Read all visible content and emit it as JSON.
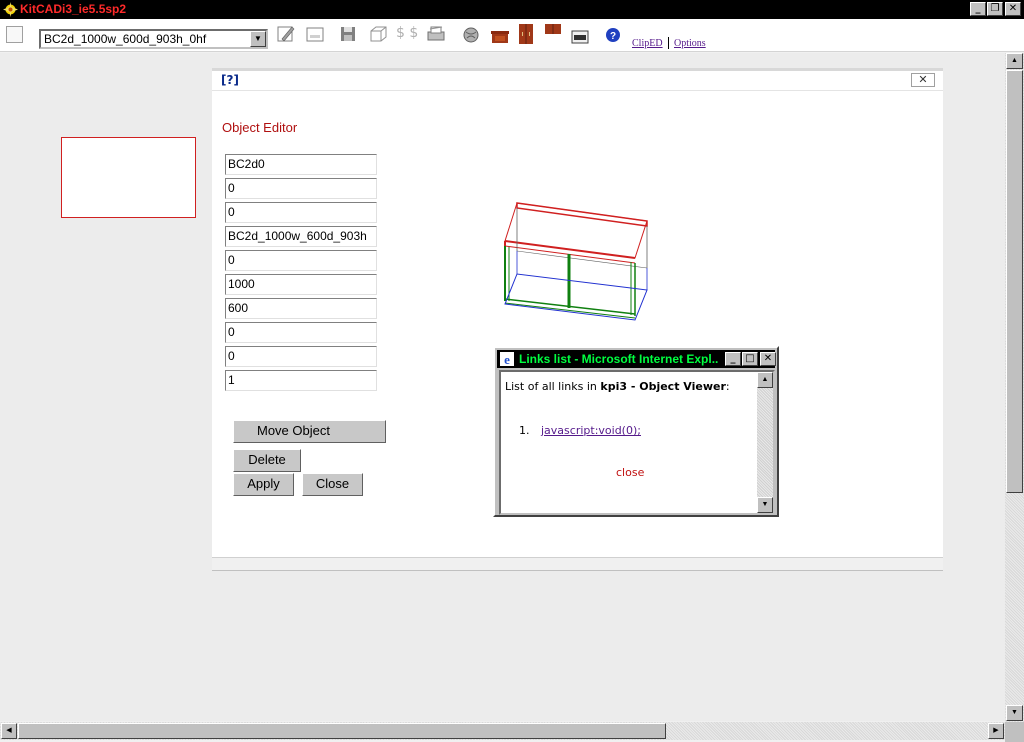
{
  "window": {
    "title": "KitCADi3_ie5.5sp2",
    "min_glyph": "_",
    "max_glyph": "❐",
    "close_glyph": "✕"
  },
  "toolbar": {
    "selected_object": "BC2d_1000w_600d_903h_0hf",
    "dollar_text": "$ $",
    "link_cliped": "ClipED",
    "link_options": "Options"
  },
  "dialog": {
    "help_label": "[?]",
    "close_glyph": "✕",
    "title": "Object Editor",
    "fields": [
      "BC2d0",
      "0",
      "0",
      "BC2d_1000w_600d_903h",
      "0",
      "1000",
      "600",
      "0",
      "0",
      "1"
    ],
    "buttons": {
      "move": "Move Object",
      "delete": "Delete",
      "apply": "Apply",
      "close": "Close"
    }
  },
  "popup": {
    "title": "Links list - Microsoft Internet Expl...",
    "text_prefix": "List of all links in ",
    "page_name": "kpi3 - Object Viewer",
    "text_suffix": ":",
    "links": [
      {
        "number": "1.",
        "href": "javascript:void(0);"
      }
    ],
    "close_label": "close"
  },
  "colors": {
    "app_title": "#ff2a2a",
    "popup_title": "#00ff40",
    "editor_title": "#b01010",
    "link": "#551a8b"
  }
}
